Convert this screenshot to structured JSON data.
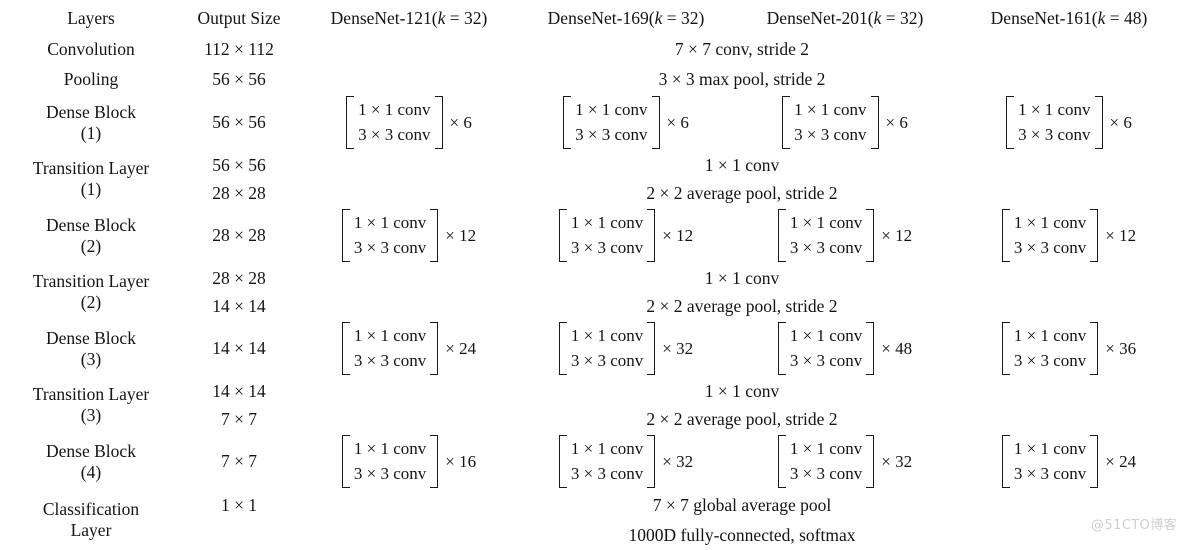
{
  "table": {
    "headers": [
      "Layers",
      "Output Size",
      "DenseNet-121(k = 32)",
      "DenseNet-169(k = 32)",
      "DenseNet-201(k = 32)",
      "DenseNet-161(k = 48)"
    ],
    "header_parts": [
      {
        "name": "DenseNet-121(",
        "k": "k",
        "eq": " = 32)"
      },
      {
        "name": "DenseNet-169(",
        "k": "k",
        "eq": " = 32)"
      },
      {
        "name": "DenseNet-201(",
        "k": "k",
        "eq": " = 32)"
      },
      {
        "name": "DenseNet-161(",
        "k": "k",
        "eq": " = 48)"
      }
    ],
    "rows": {
      "convolution": {
        "layer": "Convolution",
        "output_size": "112 × 112",
        "spec": "7 × 7 conv, stride 2"
      },
      "pooling": {
        "layer": "Pooling",
        "output_size": "56 × 56",
        "spec": "3 × 3 max pool, stride 2"
      },
      "dense_block_1": {
        "layer": "Dense Block",
        "layer_sub": "(1)",
        "output_size": "56 × 56",
        "conv_top": "1 × 1 conv",
        "conv_bottom": "3 × 3 conv",
        "repeats": [
          "× 6",
          "× 6",
          "× 6",
          "× 6"
        ]
      },
      "transition_layer_1": {
        "layer": "Transition Layer",
        "layer_sub": "(1)",
        "output_size_a": "56 × 56",
        "output_size_b": "28 × 28",
        "spec_a": "1 × 1 conv",
        "spec_b": "2 × 2 average pool, stride 2"
      },
      "dense_block_2": {
        "layer": "Dense Block",
        "layer_sub": "(2)",
        "output_size": "28 × 28",
        "conv_top": "1 × 1 conv",
        "conv_bottom": "3 × 3 conv",
        "repeats": [
          "× 12",
          "× 12",
          "× 12",
          "× 12"
        ]
      },
      "transition_layer_2": {
        "layer": "Transition Layer",
        "layer_sub": "(2)",
        "output_size_a": "28 × 28",
        "output_size_b": "14 × 14",
        "spec_a": "1 × 1 conv",
        "spec_b": "2 × 2 average pool, stride 2"
      },
      "dense_block_3": {
        "layer": "Dense Block",
        "layer_sub": "(3)",
        "output_size": "14 × 14",
        "conv_top": "1 × 1 conv",
        "conv_bottom": "3 × 3 conv",
        "repeats": [
          "× 24",
          "× 32",
          "× 48",
          "× 36"
        ]
      },
      "transition_layer_3": {
        "layer": "Transition Layer",
        "layer_sub": "(3)",
        "output_size_a": "14 × 14",
        "output_size_b": "7 × 7",
        "spec_a": "1 × 1 conv",
        "spec_b": "2 × 2 average pool, stride 2"
      },
      "dense_block_4": {
        "layer": "Dense Block",
        "layer_sub": "(4)",
        "output_size": "7 × 7",
        "conv_top": "1 × 1 conv",
        "conv_bottom": "3 × 3 conv",
        "repeats": [
          "× 16",
          "× 32",
          "× 32",
          "× 24"
        ]
      },
      "classification": {
        "layer": "Classification",
        "layer_sub": "Layer",
        "output_size_a": "1 × 1",
        "output_size_b": "",
        "spec_a": "7 × 7 global average pool",
        "spec_b": "1000D fully-connected, softmax"
      }
    }
  },
  "watermark": {
    "text": "@51CTO博客"
  },
  "colors": {
    "rule": "#6e6e6e",
    "heavy_rule": "#555555",
    "text": "#141414",
    "watermark": "#cfcfcf"
  }
}
